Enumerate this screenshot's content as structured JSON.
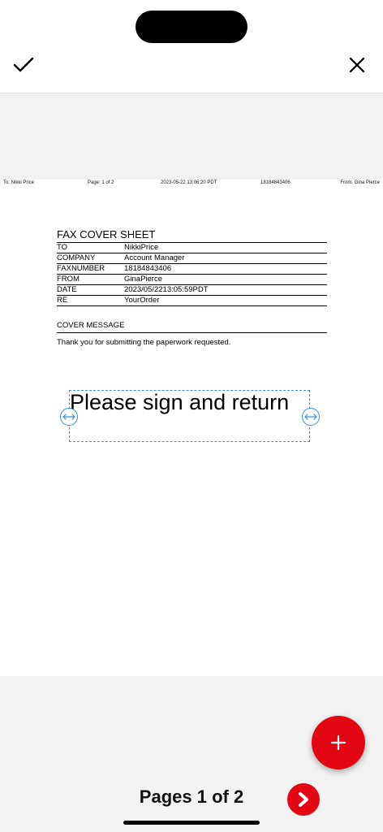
{
  "fax_header": {
    "to": "To: Nikki Price",
    "page": "Page: 1 of 2",
    "date": "2023-05-22 13:06:20 PDT",
    "number": "18184843406",
    "from": "From: Gina Pierce"
  },
  "cover": {
    "title": "FAX COVER SHEET",
    "rows": [
      {
        "label": "TO",
        "value": "NikkiPrice"
      },
      {
        "label": "COMPANY",
        "value": "Account Manager"
      },
      {
        "label": "FAXNUMBER",
        "value": "18184843406"
      },
      {
        "label": "FROM",
        "value": "GinaPierce"
      },
      {
        "label": "DATE",
        "value": "2023/05/2213:05:59PDT"
      },
      {
        "label": "RE",
        "value": "YourOrder"
      }
    ],
    "message_title": "COVER MESSAGE",
    "message": "Thank you for submitting the paperwork requested."
  },
  "annotation": {
    "text": "Please sign and return"
  },
  "pager": {
    "label": "Pages 1 of 2"
  },
  "icons": {
    "confirm": "checkmark-icon",
    "close": "close-icon",
    "resize": "resize-horizontal-icon",
    "add": "plus-icon",
    "next": "chevron-right-icon"
  },
  "colors": {
    "accent": "#e30613",
    "selection": "#3a8fd6"
  }
}
